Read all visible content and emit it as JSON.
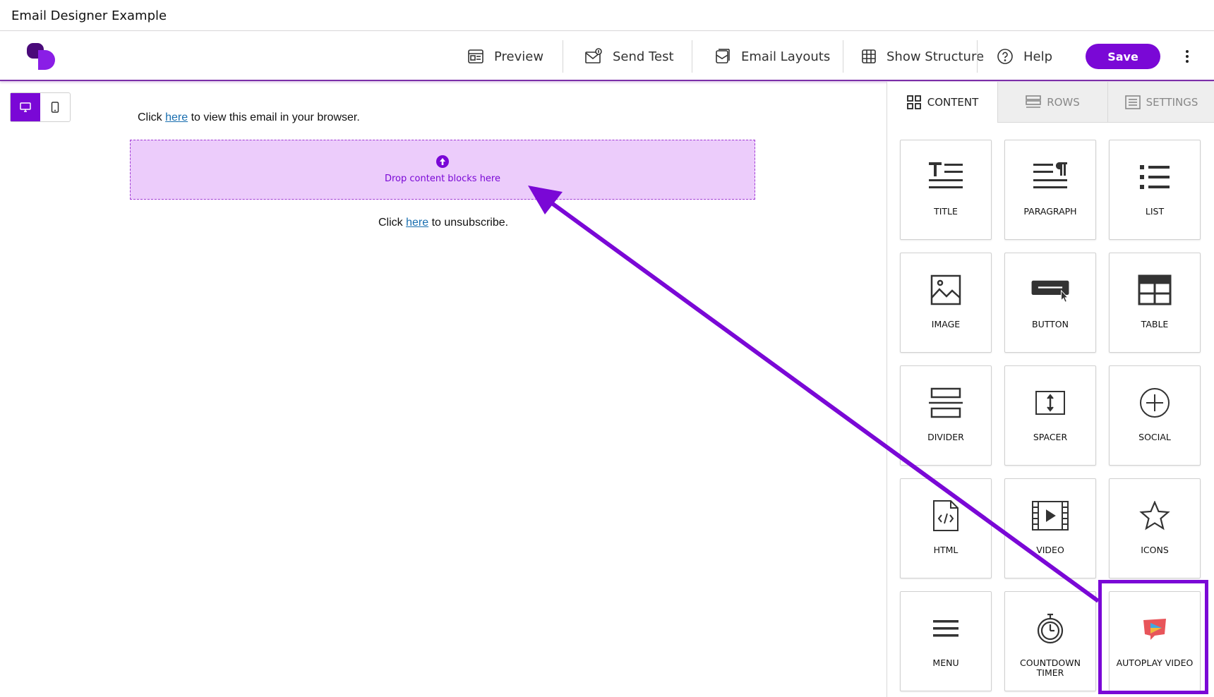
{
  "window": {
    "title": "Email Designer Example"
  },
  "toolbar": {
    "preview": "Preview",
    "send_test": "Send Test",
    "email_layouts": "Email Layouts",
    "show_structure": "Show Structure",
    "help": "Help",
    "save": "Save"
  },
  "canvas": {
    "top_line": {
      "before": "Click ",
      "link": "here",
      "after": " to view this email in your browser."
    },
    "dropzone": "Drop content blocks here",
    "bottom_line": {
      "before": "Click ",
      "link": "here",
      "after": " to unsubscribe."
    }
  },
  "panel": {
    "tabs": [
      {
        "label": "CONTENT",
        "active": true
      },
      {
        "label": "ROWS",
        "active": false
      },
      {
        "label": "SETTINGS",
        "active": false
      }
    ],
    "blocks": [
      {
        "label": "TITLE",
        "icon": "title-icon"
      },
      {
        "label": "PARAGRAPH",
        "icon": "paragraph-icon"
      },
      {
        "label": "LIST",
        "icon": "list-icon"
      },
      {
        "label": "IMAGE",
        "icon": "image-icon"
      },
      {
        "label": "BUTTON",
        "icon": "button-icon"
      },
      {
        "label": "TABLE",
        "icon": "table-icon"
      },
      {
        "label": "DIVIDER",
        "icon": "divider-icon"
      },
      {
        "label": "SPACER",
        "icon": "spacer-icon"
      },
      {
        "label": "SOCIAL",
        "icon": "social-icon"
      },
      {
        "label": "HTML",
        "icon": "html-icon"
      },
      {
        "label": "VIDEO",
        "icon": "video-icon"
      },
      {
        "label": "ICONS",
        "icon": "star-icon"
      },
      {
        "label": "MENU",
        "icon": "menu-icon"
      },
      {
        "label": "COUNTDOWN TIMER",
        "icon": "stopwatch-icon"
      },
      {
        "label": "AUTOPLAY VIDEO",
        "icon": "autoplay-video-icon"
      }
    ]
  },
  "colors": {
    "accent": "#7a08d6",
    "dropzone_bg": "#ecccfb",
    "link": "#1a6fb0"
  }
}
